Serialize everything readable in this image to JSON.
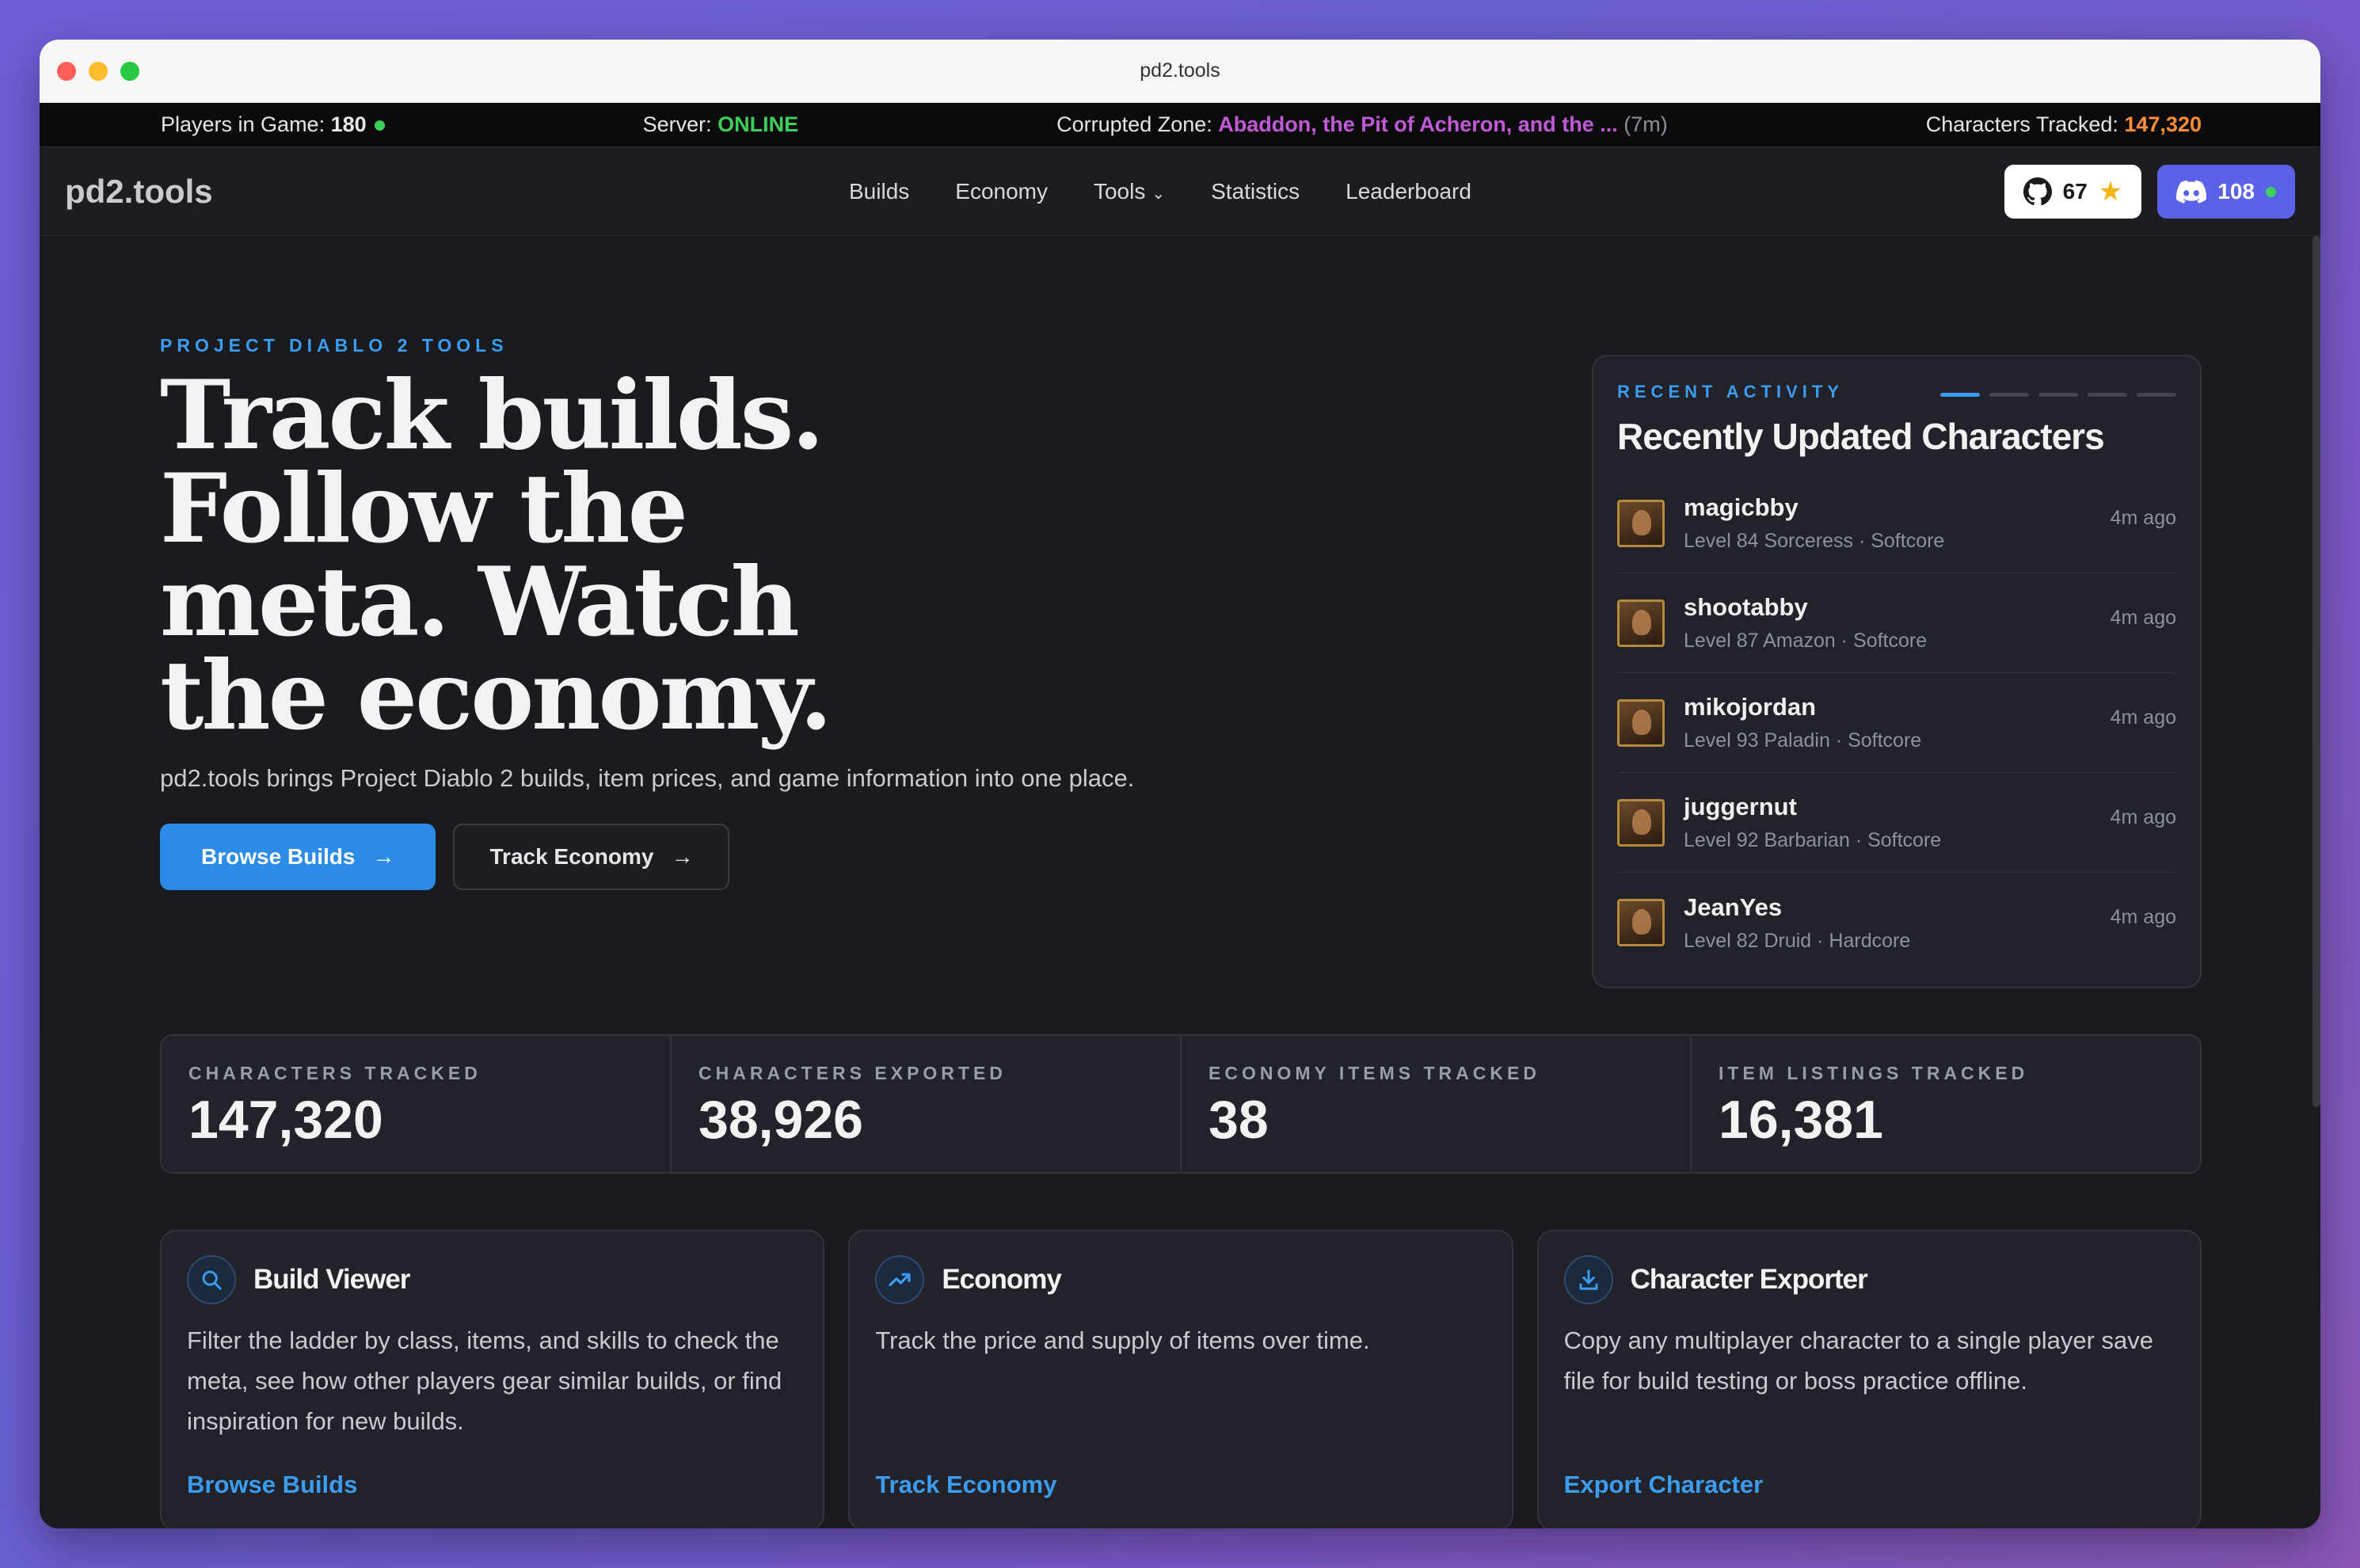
{
  "window": {
    "title": "pd2.tools"
  },
  "status": {
    "players_label": "Players in Game:",
    "players_value": "180",
    "server_label": "Server:",
    "server_value": "ONLINE",
    "zone_label": "Corrupted Zone:",
    "zone_value": "Abaddon, the Pit of Acheron, and the ...",
    "zone_time": "(7m)",
    "tracked_label": "Characters Tracked:",
    "tracked_value": "147,320"
  },
  "nav": {
    "logo": "pd2.tools",
    "links": [
      "Builds",
      "Economy",
      "Tools",
      "Statistics",
      "Leaderboard"
    ],
    "github_count": "67",
    "discord_count": "108"
  },
  "hero": {
    "eyebrow": "PROJECT DIABLO 2 TOOLS",
    "headline": "Track builds. Follow the meta. Watch the economy.",
    "description": "pd2.tools brings Project Diablo 2 builds, item prices, and game information into one place.",
    "primary_button": "Browse Builds",
    "secondary_button": "Track Economy"
  },
  "activity": {
    "eyebrow": "RECENT ACTIVITY",
    "title": "Recently Updated Characters",
    "items": [
      {
        "name": "magicbby",
        "sub": "Level 84 Sorceress · Softcore",
        "time": "4m ago"
      },
      {
        "name": "shootabby",
        "sub": "Level 87 Amazon · Softcore",
        "time": "4m ago"
      },
      {
        "name": "mikojordan",
        "sub": "Level 93 Paladin · Softcore",
        "time": "4m ago"
      },
      {
        "name": "juggernut",
        "sub": "Level 92 Barbarian · Softcore",
        "time": "4m ago"
      },
      {
        "name": "JeanYes",
        "sub": "Level 82 Druid · Hardcore",
        "time": "4m ago"
      }
    ]
  },
  "stats": [
    {
      "label": "CHARACTERS TRACKED",
      "value": "147,320"
    },
    {
      "label": "CHARACTERS EXPORTED",
      "value": "38,926"
    },
    {
      "label": "ECONOMY ITEMS TRACKED",
      "value": "38"
    },
    {
      "label": "ITEM LISTINGS TRACKED",
      "value": "16,381"
    }
  ],
  "cards": [
    {
      "icon": "search-icon",
      "title": "Build Viewer",
      "desc": "Filter the ladder by class, items, and skills to check the meta, see how other players gear similar builds, or find inspiration for new builds.",
      "link": "Browse Builds"
    },
    {
      "icon": "trending-up-icon",
      "title": "Economy",
      "desc": "Track the price and supply of items over time.",
      "link": "Track Economy"
    },
    {
      "icon": "download-icon",
      "title": "Character Exporter",
      "desc": "Copy any multiplayer character to a single player save file for build testing or boss practice offline.",
      "link": "Export Character"
    }
  ],
  "colors": {
    "accent": "#3b9cf0",
    "online": "#3ecf5a",
    "zone": "#c25ad8",
    "tracked": "#ff8c3a",
    "discord": "#5a63e8"
  }
}
